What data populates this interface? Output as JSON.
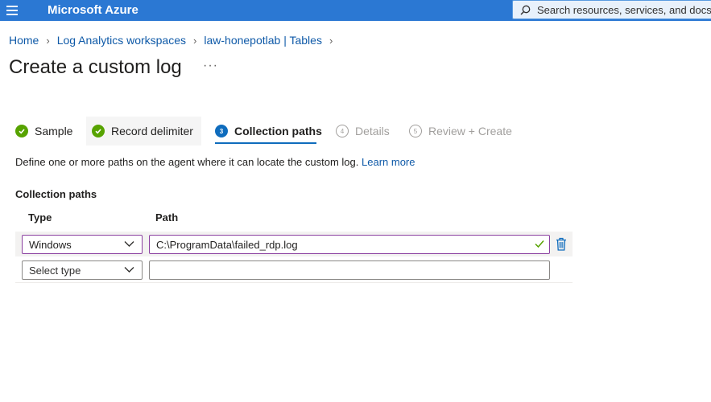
{
  "topbar": {
    "brand": "Microsoft Azure",
    "search_placeholder": "Search resources, services, and docs (G+/)"
  },
  "breadcrumb": [
    "Home",
    "Log Analytics workspaces",
    "law-honepotlab | Tables"
  ],
  "page": {
    "title": "Create a custom log",
    "more": "···"
  },
  "steps": [
    {
      "label": "Sample",
      "state": "done"
    },
    {
      "label": "Record delimiter",
      "state": "done"
    },
    {
      "number": "3",
      "label": "Collection paths",
      "state": "current"
    },
    {
      "number": "4",
      "label": "Details",
      "state": "todo"
    },
    {
      "number": "5",
      "label": "Review + Create",
      "state": "todo"
    }
  ],
  "description": {
    "text": "Define one or more paths on the agent where it can locate the custom log.",
    "link": "Learn more"
  },
  "collection_paths": {
    "title": "Collection paths",
    "headers": {
      "type": "Type",
      "path": "Path"
    },
    "rows": [
      {
        "type": "Windows",
        "path": "C:\\ProgramData\\failed_rdp.log"
      },
      {
        "type": "Select type",
        "path": ""
      }
    ]
  },
  "colors": {
    "topbar": "#2b78d3",
    "link": "#0f5aa8",
    "success": "#57a300",
    "accent": "#0f6cbd",
    "focus_border": "#8a3fa0"
  }
}
